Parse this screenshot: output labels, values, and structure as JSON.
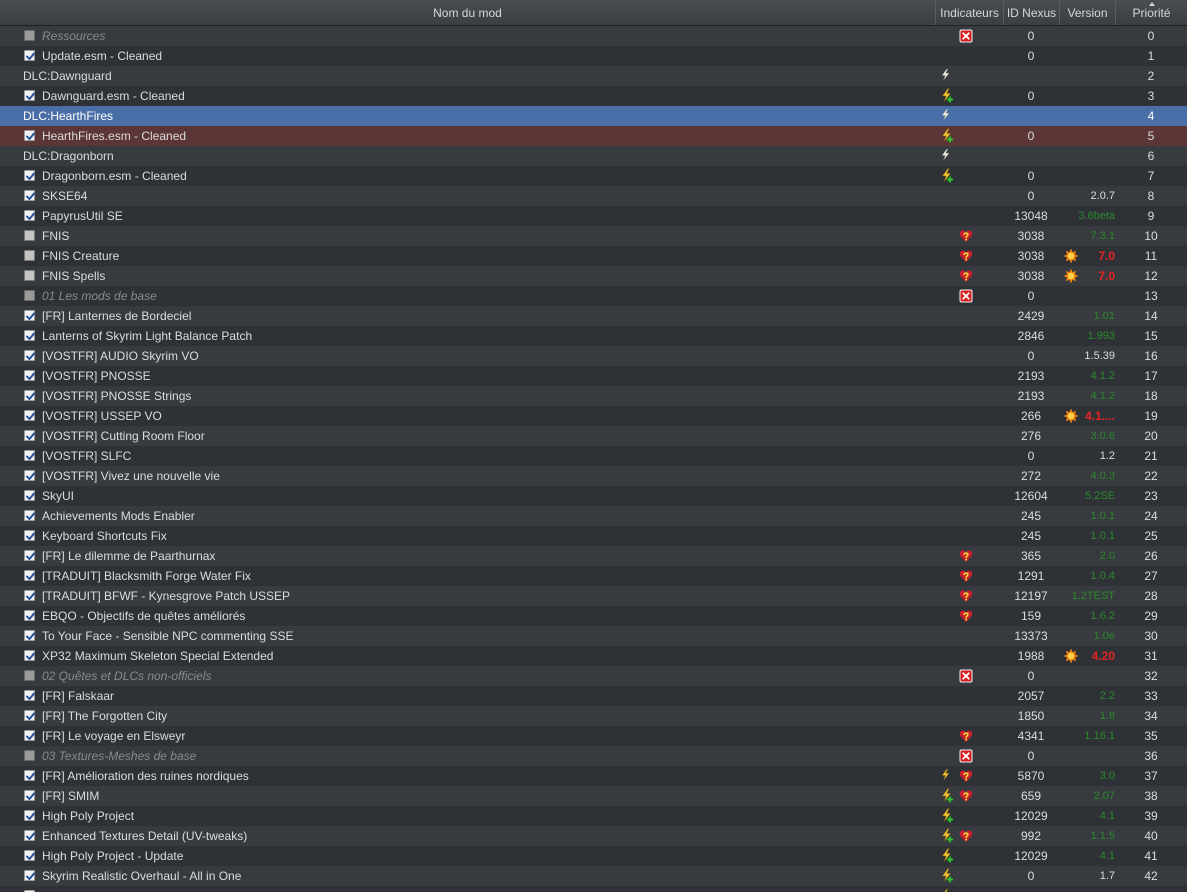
{
  "columns": {
    "name": "Nom du mod",
    "indicators": "Indicateurs",
    "nexus_id": "ID Nexus",
    "version": "Version",
    "priority": "Priorité"
  },
  "sort": {
    "column": "priority",
    "direction": "ascending",
    "icon": "sort-ascending-icon"
  },
  "colors": {
    "selected_row": "#4a6ea8",
    "highlighted_row": "#5c3637",
    "version_green": "#2c8a2c",
    "version_red": "#e42424",
    "separator_text": "#8a8a8a"
  },
  "rows": [
    {
      "name": "Ressources",
      "kind": "separator",
      "checked": false,
      "indicators": [
        "red-x-icon"
      ],
      "nexus_id": "0",
      "version": "",
      "version_status": "plain",
      "priority": "0"
    },
    {
      "name": "Update.esm - Cleaned",
      "kind": "mod",
      "checked": true,
      "indicators": [],
      "nexus_id": "0",
      "version": "",
      "version_status": "plain",
      "priority": "1"
    },
    {
      "name": "DLC:Dawnguard",
      "kind": "dlc",
      "checked": null,
      "indicators": [
        "lightning-icon"
      ],
      "nexus_id": "",
      "version": "",
      "version_status": "plain",
      "priority": "2"
    },
    {
      "name": "Dawnguard.esm - Cleaned",
      "kind": "mod",
      "checked": true,
      "indicators": [
        "lightning-plus-icon"
      ],
      "nexus_id": "0",
      "version": "",
      "version_status": "plain",
      "priority": "3"
    },
    {
      "name": "DLC:HearthFires",
      "kind": "dlc",
      "checked": null,
      "state": "selected",
      "indicators": [
        "lightning-icon"
      ],
      "nexus_id": "",
      "version": "",
      "version_status": "plain",
      "priority": "4"
    },
    {
      "name": "HearthFires.esm - Cleaned",
      "kind": "mod",
      "checked": true,
      "state": "highlighted",
      "indicators": [
        "lightning-plus-icon"
      ],
      "nexus_id": "0",
      "version": "",
      "version_status": "plain",
      "priority": "5"
    },
    {
      "name": "DLC:Dragonborn",
      "kind": "dlc",
      "checked": null,
      "indicators": [
        "lightning-icon"
      ],
      "nexus_id": "",
      "version": "",
      "version_status": "plain",
      "priority": "6"
    },
    {
      "name": "Dragonborn.esm - Cleaned",
      "kind": "mod",
      "checked": true,
      "indicators": [
        "lightning-plus-icon"
      ],
      "nexus_id": "0",
      "version": "",
      "version_status": "plain",
      "priority": "7"
    },
    {
      "name": "SKSE64",
      "kind": "mod",
      "checked": true,
      "indicators": [],
      "nexus_id": "0",
      "version": "2.0.7",
      "version_status": "plain",
      "priority": "8"
    },
    {
      "name": "PapyrusUtil SE",
      "kind": "mod",
      "checked": true,
      "indicators": [],
      "nexus_id": "13048",
      "version": "3.6beta",
      "version_status": "green",
      "priority": "9"
    },
    {
      "name": "FNIS",
      "kind": "mod",
      "checked": false,
      "indicators": [
        "heart-question-icon"
      ],
      "nexus_id": "3038",
      "version": "7.3.1",
      "version_status": "green",
      "priority": "10"
    },
    {
      "name": "FNIS Creature",
      "kind": "mod",
      "checked": false,
      "indicators": [
        "heart-question-icon"
      ],
      "nexus_id": "3038",
      "version": "7.0",
      "version_status": "red",
      "version_flag": "starburst-icon",
      "priority": "11"
    },
    {
      "name": "FNIS Spells",
      "kind": "mod",
      "checked": false,
      "indicators": [
        "heart-question-icon"
      ],
      "nexus_id": "3038",
      "version": "7.0",
      "version_status": "red",
      "version_flag": "starburst-icon",
      "priority": "12"
    },
    {
      "name": "01 Les mods de base",
      "kind": "separator",
      "checked": false,
      "indicators": [
        "red-x-icon"
      ],
      "nexus_id": "0",
      "version": "",
      "version_status": "plain",
      "priority": "13"
    },
    {
      "name": "[FR] Lanternes de Bordeciel",
      "kind": "mod",
      "checked": true,
      "indicators": [],
      "nexus_id": "2429",
      "version": "1.01",
      "version_status": "green",
      "priority": "14"
    },
    {
      "name": "Lanterns of Skyrim Light Balance Patch",
      "kind": "mod",
      "checked": true,
      "indicators": [],
      "nexus_id": "2846",
      "version": "1.993",
      "version_status": "green",
      "priority": "15"
    },
    {
      "name": "[VOSTFR] AUDIO Skyrim VO",
      "kind": "mod",
      "checked": true,
      "indicators": [],
      "nexus_id": "0",
      "version": "1.5.39",
      "version_status": "plain",
      "priority": "16"
    },
    {
      "name": "[VOSTFR] PNOSSE",
      "kind": "mod",
      "checked": true,
      "indicators": [],
      "nexus_id": "2193",
      "version": "4.1.2",
      "version_status": "green",
      "priority": "17"
    },
    {
      "name": "[VOSTFR] PNOSSE Strings",
      "kind": "mod",
      "checked": true,
      "indicators": [],
      "nexus_id": "2193",
      "version": "4.1.2",
      "version_status": "green",
      "priority": "18"
    },
    {
      "name": "[VOSTFR] USSEP VO",
      "kind": "mod",
      "checked": true,
      "indicators": [],
      "nexus_id": "266",
      "version": "4.1....",
      "version_status": "red",
      "version_flag": "starburst-icon",
      "priority": "19"
    },
    {
      "name": "[VOSTFR] Cutting Room Floor",
      "kind": "mod",
      "checked": true,
      "indicators": [],
      "nexus_id": "276",
      "version": "3.0.6",
      "version_status": "green",
      "priority": "20"
    },
    {
      "name": "[VOSTFR] SLFC",
      "kind": "mod",
      "checked": true,
      "indicators": [],
      "nexus_id": "0",
      "version": "1.2",
      "version_status": "plain",
      "priority": "21"
    },
    {
      "name": "[VOSTFR] Vivez une nouvelle vie",
      "kind": "mod",
      "checked": true,
      "indicators": [],
      "nexus_id": "272",
      "version": "4.0.3",
      "version_status": "green",
      "priority": "22"
    },
    {
      "name": "SkyUI",
      "kind": "mod",
      "checked": true,
      "indicators": [],
      "nexus_id": "12604",
      "version": "5.2SE",
      "version_status": "green",
      "priority": "23"
    },
    {
      "name": "Achievements Mods Enabler",
      "kind": "mod",
      "checked": true,
      "indicators": [],
      "nexus_id": "245",
      "version": "1.0.1",
      "version_status": "green",
      "priority": "24"
    },
    {
      "name": "Keyboard Shortcuts Fix",
      "kind": "mod",
      "checked": true,
      "indicators": [],
      "nexus_id": "245",
      "version": "1.0.1",
      "version_status": "green",
      "priority": "25"
    },
    {
      "name": "[FR] Le dilemme de Paarthurnax",
      "kind": "mod",
      "checked": true,
      "indicators": [
        "heart-question-icon"
      ],
      "nexus_id": "365",
      "version": "2.0",
      "version_status": "green",
      "priority": "26"
    },
    {
      "name": "[TRADUIT] Blacksmith Forge Water Fix",
      "kind": "mod",
      "checked": true,
      "indicators": [
        "heart-question-icon"
      ],
      "nexus_id": "1291",
      "version": "1.0.4",
      "version_status": "green",
      "priority": "27"
    },
    {
      "name": "[TRADUIT] BFWF - Kynesgrove Patch USSEP",
      "kind": "mod",
      "checked": true,
      "indicators": [
        "heart-question-icon"
      ],
      "nexus_id": "12197",
      "version": "1.2TEST",
      "version_status": "green",
      "priority": "28"
    },
    {
      "name": "EBQO - Objectifs de quêtes améliorés",
      "kind": "mod",
      "checked": true,
      "indicators": [
        "heart-question-icon"
      ],
      "nexus_id": "159",
      "version": "1.6.2",
      "version_status": "green",
      "priority": "29"
    },
    {
      "name": "To Your Face - Sensible NPC commenting SSE",
      "kind": "mod",
      "checked": true,
      "indicators": [],
      "nexus_id": "13373",
      "version": "1.0e",
      "version_status": "green",
      "priority": "30"
    },
    {
      "name": "XP32 Maximum Skeleton Special Extended",
      "kind": "mod",
      "checked": true,
      "indicators": [],
      "nexus_id": "1988",
      "version": "4.20",
      "version_status": "red",
      "version_flag": "starburst-icon",
      "priority": "31"
    },
    {
      "name": "02 Quêtes et DLCs non-officiels",
      "kind": "separator",
      "checked": false,
      "indicators": [
        "red-x-icon"
      ],
      "nexus_id": "0",
      "version": "",
      "version_status": "plain",
      "priority": "32"
    },
    {
      "name": "[FR] Falskaar",
      "kind": "mod",
      "checked": true,
      "indicators": [],
      "nexus_id": "2057",
      "version": "2.2",
      "version_status": "green",
      "priority": "33"
    },
    {
      "name": "[FR] The Forgotten City",
      "kind": "mod",
      "checked": true,
      "indicators": [],
      "nexus_id": "1850",
      "version": "1.8",
      "version_status": "green",
      "priority": "34"
    },
    {
      "name": "[FR] Le voyage en Elsweyr",
      "kind": "mod",
      "checked": true,
      "indicators": [
        "heart-question-icon"
      ],
      "nexus_id": "4341",
      "version": "1.16.1",
      "version_status": "green",
      "priority": "35"
    },
    {
      "name": "03 Textures-Meshes de base",
      "kind": "separator",
      "checked": false,
      "indicators": [
        "red-x-icon"
      ],
      "nexus_id": "0",
      "version": "",
      "version_status": "plain",
      "priority": "36"
    },
    {
      "name": "[FR] Amélioration des ruines nordiques",
      "kind": "mod",
      "checked": true,
      "indicators": [
        "lightning-yellow-icon",
        "heart-question-icon"
      ],
      "nexus_id": "5870",
      "version": "3.0",
      "version_status": "green",
      "priority": "37"
    },
    {
      "name": "[FR] SMIM",
      "kind": "mod",
      "checked": true,
      "indicators": [
        "lightning-plus-icon",
        "heart-question-icon"
      ],
      "nexus_id": "659",
      "version": "2.07",
      "version_status": "green",
      "priority": "38"
    },
    {
      "name": "High Poly Project",
      "kind": "mod",
      "checked": true,
      "indicators": [
        "lightning-plus-icon"
      ],
      "nexus_id": "12029",
      "version": "4.1",
      "version_status": "green",
      "priority": "39"
    },
    {
      "name": "Enhanced Textures Detail (UV-tweaks)",
      "kind": "mod",
      "checked": true,
      "indicators": [
        "lightning-plus-icon",
        "heart-question-icon"
      ],
      "nexus_id": "992",
      "version": "1.1.5",
      "version_status": "green",
      "priority": "40"
    },
    {
      "name": "High Poly Project - Update",
      "kind": "mod",
      "checked": true,
      "indicators": [
        "lightning-plus-icon"
      ],
      "nexus_id": "12029",
      "version": "4.1",
      "version_status": "green",
      "priority": "41"
    },
    {
      "name": "Skyrim Realistic Overhaul - All in One",
      "kind": "mod",
      "checked": true,
      "indicators": [
        "lightning-plus-icon"
      ],
      "nexus_id": "0",
      "version": "1.7",
      "version_status": "plain",
      "priority": "42"
    },
    {
      "name": "",
      "kind": "mod",
      "checked": true,
      "indicators": [
        "lightning-yellow-icon"
      ],
      "nexus_id": "",
      "version": "",
      "version_status": "plain",
      "priority": ""
    }
  ]
}
